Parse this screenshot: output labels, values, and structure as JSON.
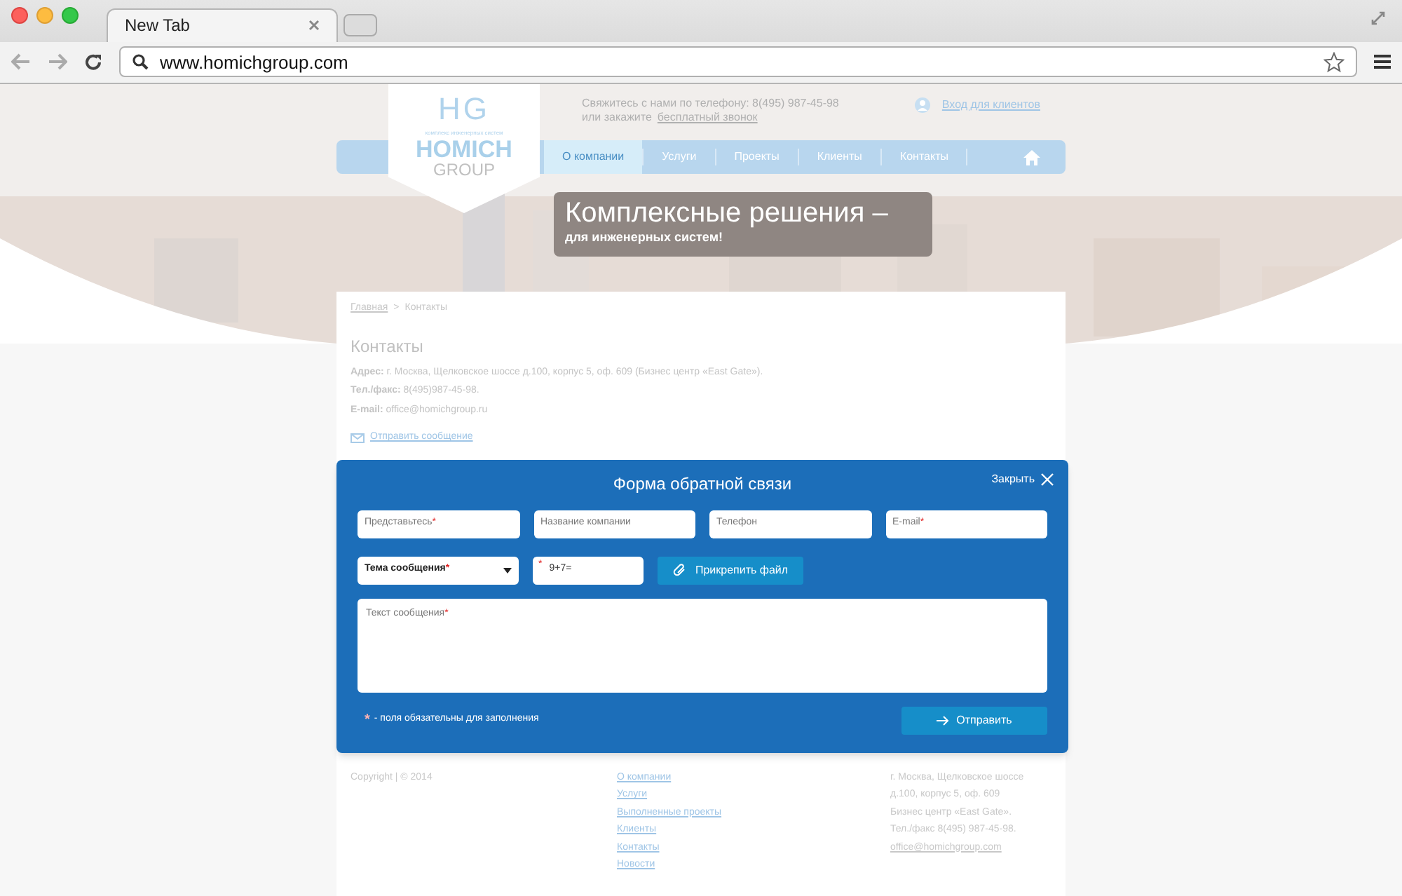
{
  "browser": {
    "tab_title": "New Tab",
    "url": "www.homichgroup.com"
  },
  "header": {
    "logo": {
      "mark": "HG",
      "tagline": "комплекс инженерных систем",
      "name": "HOMICH",
      "sub": "GROUP"
    },
    "contact_line": "Свяжитесь с нами по телефону: 8(495) 987-45-98",
    "callback_prefix": "или закажите",
    "callback_link": "бесплатный звонок",
    "login": "Вход для клиентов"
  },
  "nav": [
    {
      "label": "О компании",
      "selected": true
    },
    {
      "label": "Услуги",
      "selected": false
    },
    {
      "label": "Проекты",
      "selected": false
    },
    {
      "label": "Клиенты",
      "selected": false
    },
    {
      "label": "Контакты",
      "selected": false
    }
  ],
  "banner": {
    "title": "Комплексные решения –",
    "subtitle": "для инженерных систем!"
  },
  "breadcrumb": {
    "home": "Главная",
    "separator": ">",
    "current": "Контакты"
  },
  "contacts": {
    "title": "Контакты",
    "lines": [
      "**Адрес:** г. Москва, Щелковское шоссе д.100, корпус 5, оф. 609 (Бизнес центр «East Gate»).",
      "**Тел./факс:** 8(495)987-45-98.",
      "**E-mail:** office@homichgroup.ru"
    ],
    "send_link": "Отправить сообщение"
  },
  "modal": {
    "title": "Форма обратной связи",
    "close": "Закрыть",
    "fields": [
      {
        "kind": "input",
        "placeholder": "Представьтесь",
        "required_mark": "*"
      },
      {
        "kind": "input",
        "placeholder": "Название компании"
      },
      {
        "kind": "input",
        "placeholder": "Телефон"
      },
      {
        "kind": "input",
        "placeholder": "E-mail",
        "required_mark": "*"
      }
    ],
    "topic": {
      "value": "Тема сообщения",
      "required_mark": "*"
    },
    "captcha": {
      "value": "9+7=",
      "required_mark": "*"
    },
    "attach": "Прикрепить файл",
    "message": {
      "placeholder": "Текст сообщения",
      "required_mark": "*"
    },
    "note_mark": "*",
    "required_note": "- поля обязательны для заполнения",
    "submit": "Отправить"
  },
  "footer": {
    "copyright": "Copyright | © 2014",
    "links": [
      "О компании",
      "Услуги",
      "Выполненные проекты",
      "Клиенты",
      "Контакты",
      "Новости"
    ],
    "address": [
      "г. Москва, Щелковское шоссе",
      "д.100, корпус 5, оф. 609",
      "Бизнес центр «East Gate».",
      "Тел./факс 8(495) 987-45-98."
    ],
    "email": "office@homichgroup.com"
  }
}
